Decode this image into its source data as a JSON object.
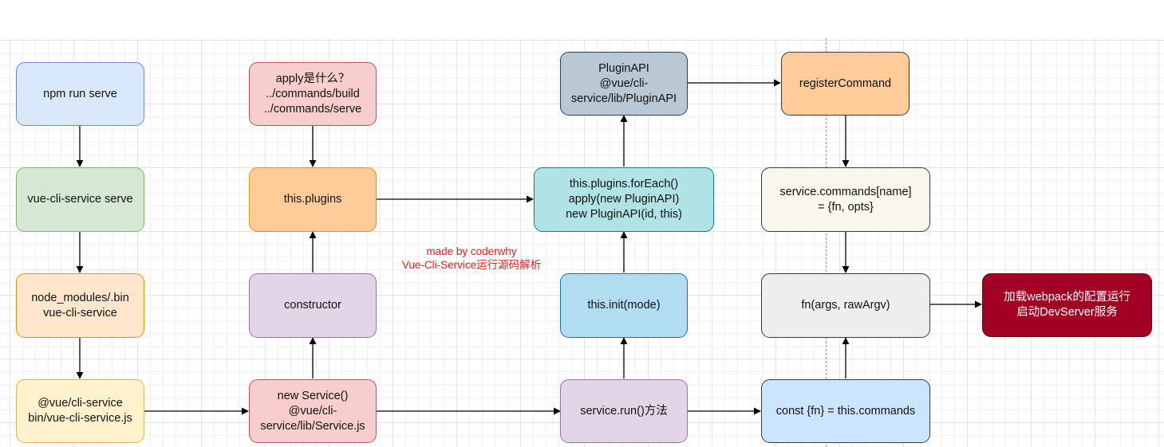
{
  "colors": {
    "blue": {
      "fill": "#dae8fc",
      "stroke": "#6c8ebf"
    },
    "green": {
      "fill": "#d5e8d4",
      "stroke": "#82b366"
    },
    "orange_light": {
      "fill": "#ffe6cc",
      "stroke": "#d79b00"
    },
    "yellow": {
      "fill": "#fff2cc",
      "stroke": "#d6b656"
    },
    "red_light": {
      "fill": "#f8cecc",
      "stroke": "#b85450"
    },
    "orange": {
      "fill": "#ffcc99",
      "stroke": "#d79b00"
    },
    "purple": {
      "fill": "#e1d5e7",
      "stroke": "#9673a6"
    },
    "slate": {
      "fill": "#bac8d3",
      "stroke": "#23445d"
    },
    "cyan": {
      "fill": "#b0e3e6",
      "stroke": "#0e8088"
    },
    "sky": {
      "fill": "#b1ddf0",
      "stroke": "#10739e"
    },
    "cream": {
      "fill": "#f9f7ed",
      "stroke": "#36393d"
    },
    "gray": {
      "fill": "#eeeeee",
      "stroke": "#36393d"
    },
    "light_blue": {
      "fill": "#cce5ff",
      "stroke": "#36393d"
    },
    "dark_red": {
      "fill": "#a20025",
      "stroke": "#6f0000"
    },
    "arrow": "#000000",
    "note_text": "#e0201c"
  },
  "nodes": {
    "npm_run_serve": "npm run serve",
    "vue_cli_service_serve": "vue-cli-service serve",
    "node_modules_bin": "node_modules/.bin\nvue-cli-service",
    "vue_cli_service_js": "@vue/cli-service\nbin/vue-cli-service.js",
    "apply_question": "apply是什么？\n../commands/build\n../commands/serve",
    "this_plugins": "this.plugins",
    "constructor": "constructor",
    "new_service": "new Service()\n@vue/cli-\nservice/lib/Service.js",
    "plugin_api": "PluginAPI\n@vue/cli-\nservice/lib/PluginAPI",
    "plugins_foreach": "this.plugins.forEach()\napply(new PluginAPI)\nnew PluginAPI(id, this)",
    "this_init": "this.init(mode)",
    "service_run": "service.run()方法",
    "register_command": "registerCommand",
    "service_commands": "service.commands[name]\n= {fn, opts}",
    "fn_args": "fn(args, rawArgv)",
    "const_fn": "const {fn} = this.commands",
    "load_webpack": "加载webpack的配置运行\n启动DevServer服务"
  },
  "note": "made by coderwhy\nVue-Cli-Service运行源码解析"
}
